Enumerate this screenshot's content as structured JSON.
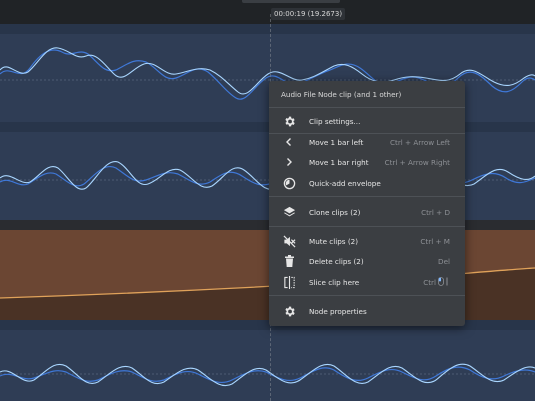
{
  "timeline": {
    "time_label": "00:00:19 (19.2673)"
  },
  "menu": {
    "title": "Audio File Node clip (and 1 other)",
    "items": [
      {
        "label": "Clip settings...",
        "shortcut": "",
        "icon": "gear-icon"
      },
      {
        "label": "Move 1 bar left",
        "shortcut": "Ctrl + Arrow Left",
        "icon": "chevron-left-icon"
      },
      {
        "label": "Move 1 bar right",
        "shortcut": "Ctrl + Arrow Right",
        "icon": "chevron-right-icon"
      },
      {
        "label": "Quick-add envelope",
        "shortcut": "",
        "icon": "envelope-dial-icon"
      },
      {
        "label": "Clone clips (2)",
        "shortcut": "Ctrl + D",
        "icon": "layers-icon"
      },
      {
        "label": "Mute clips (2)",
        "shortcut": "Ctrl + M",
        "icon": "speaker-muted-icon"
      },
      {
        "label": "Delete clips (2)",
        "shortcut": "Del",
        "icon": "trash-icon"
      },
      {
        "label": "Slice clip here",
        "shortcut": "Ctrl",
        "icon": "slice-icon"
      },
      {
        "label": "Node properties",
        "shortcut": "",
        "icon": "gear-icon"
      }
    ]
  },
  "colors": {
    "background": "#1f2226",
    "track_blue": "#2f3d55",
    "track_header": "#28354a",
    "wave_light": "#8ec8ff",
    "wave_dark": "#3f78d8",
    "track_orange": "#6b4633",
    "envelope": "#e0a25a",
    "menu_bg": "#3b3e42"
  }
}
